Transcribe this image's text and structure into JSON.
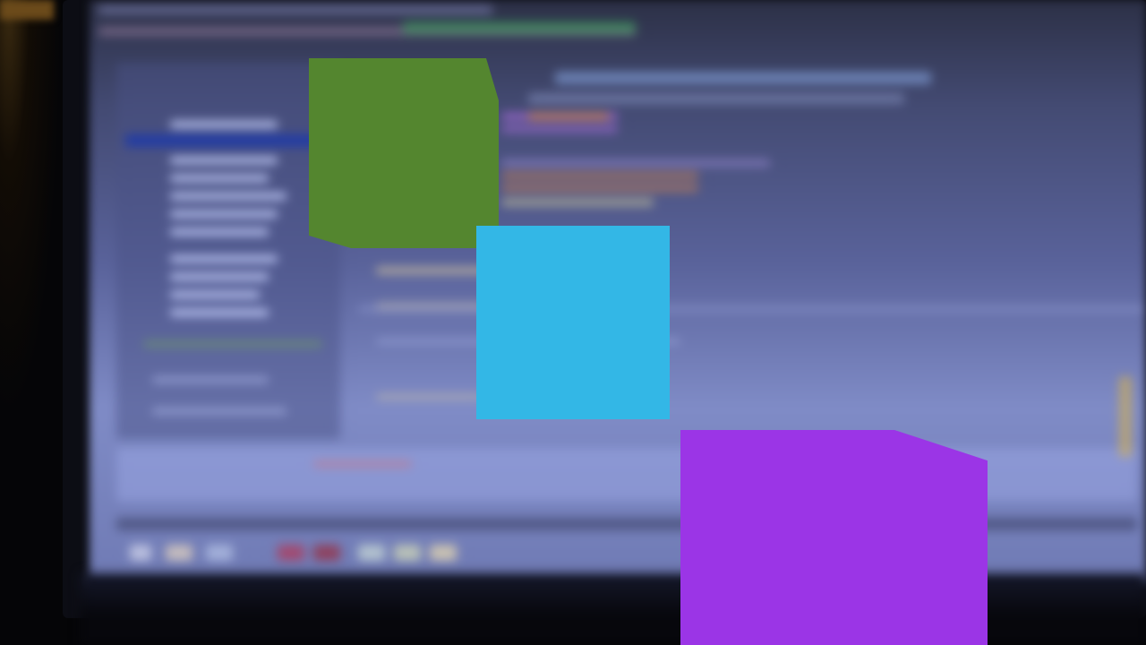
{
  "photo": {
    "subject": "out-of-focus-monitor-with-code-editor",
    "colors": {
      "background": "#050507",
      "screen_top": "#2c3046",
      "screen_bottom": "#7f8bc6",
      "highlight_bar": "#1f3aa8"
    }
  },
  "patches": [
    {
      "name": "green-patch",
      "color": "#54862f"
    },
    {
      "name": "cyan-patch",
      "color": "#33b7e6"
    },
    {
      "name": "purple-patch",
      "color": "#9b35e6"
    }
  ]
}
